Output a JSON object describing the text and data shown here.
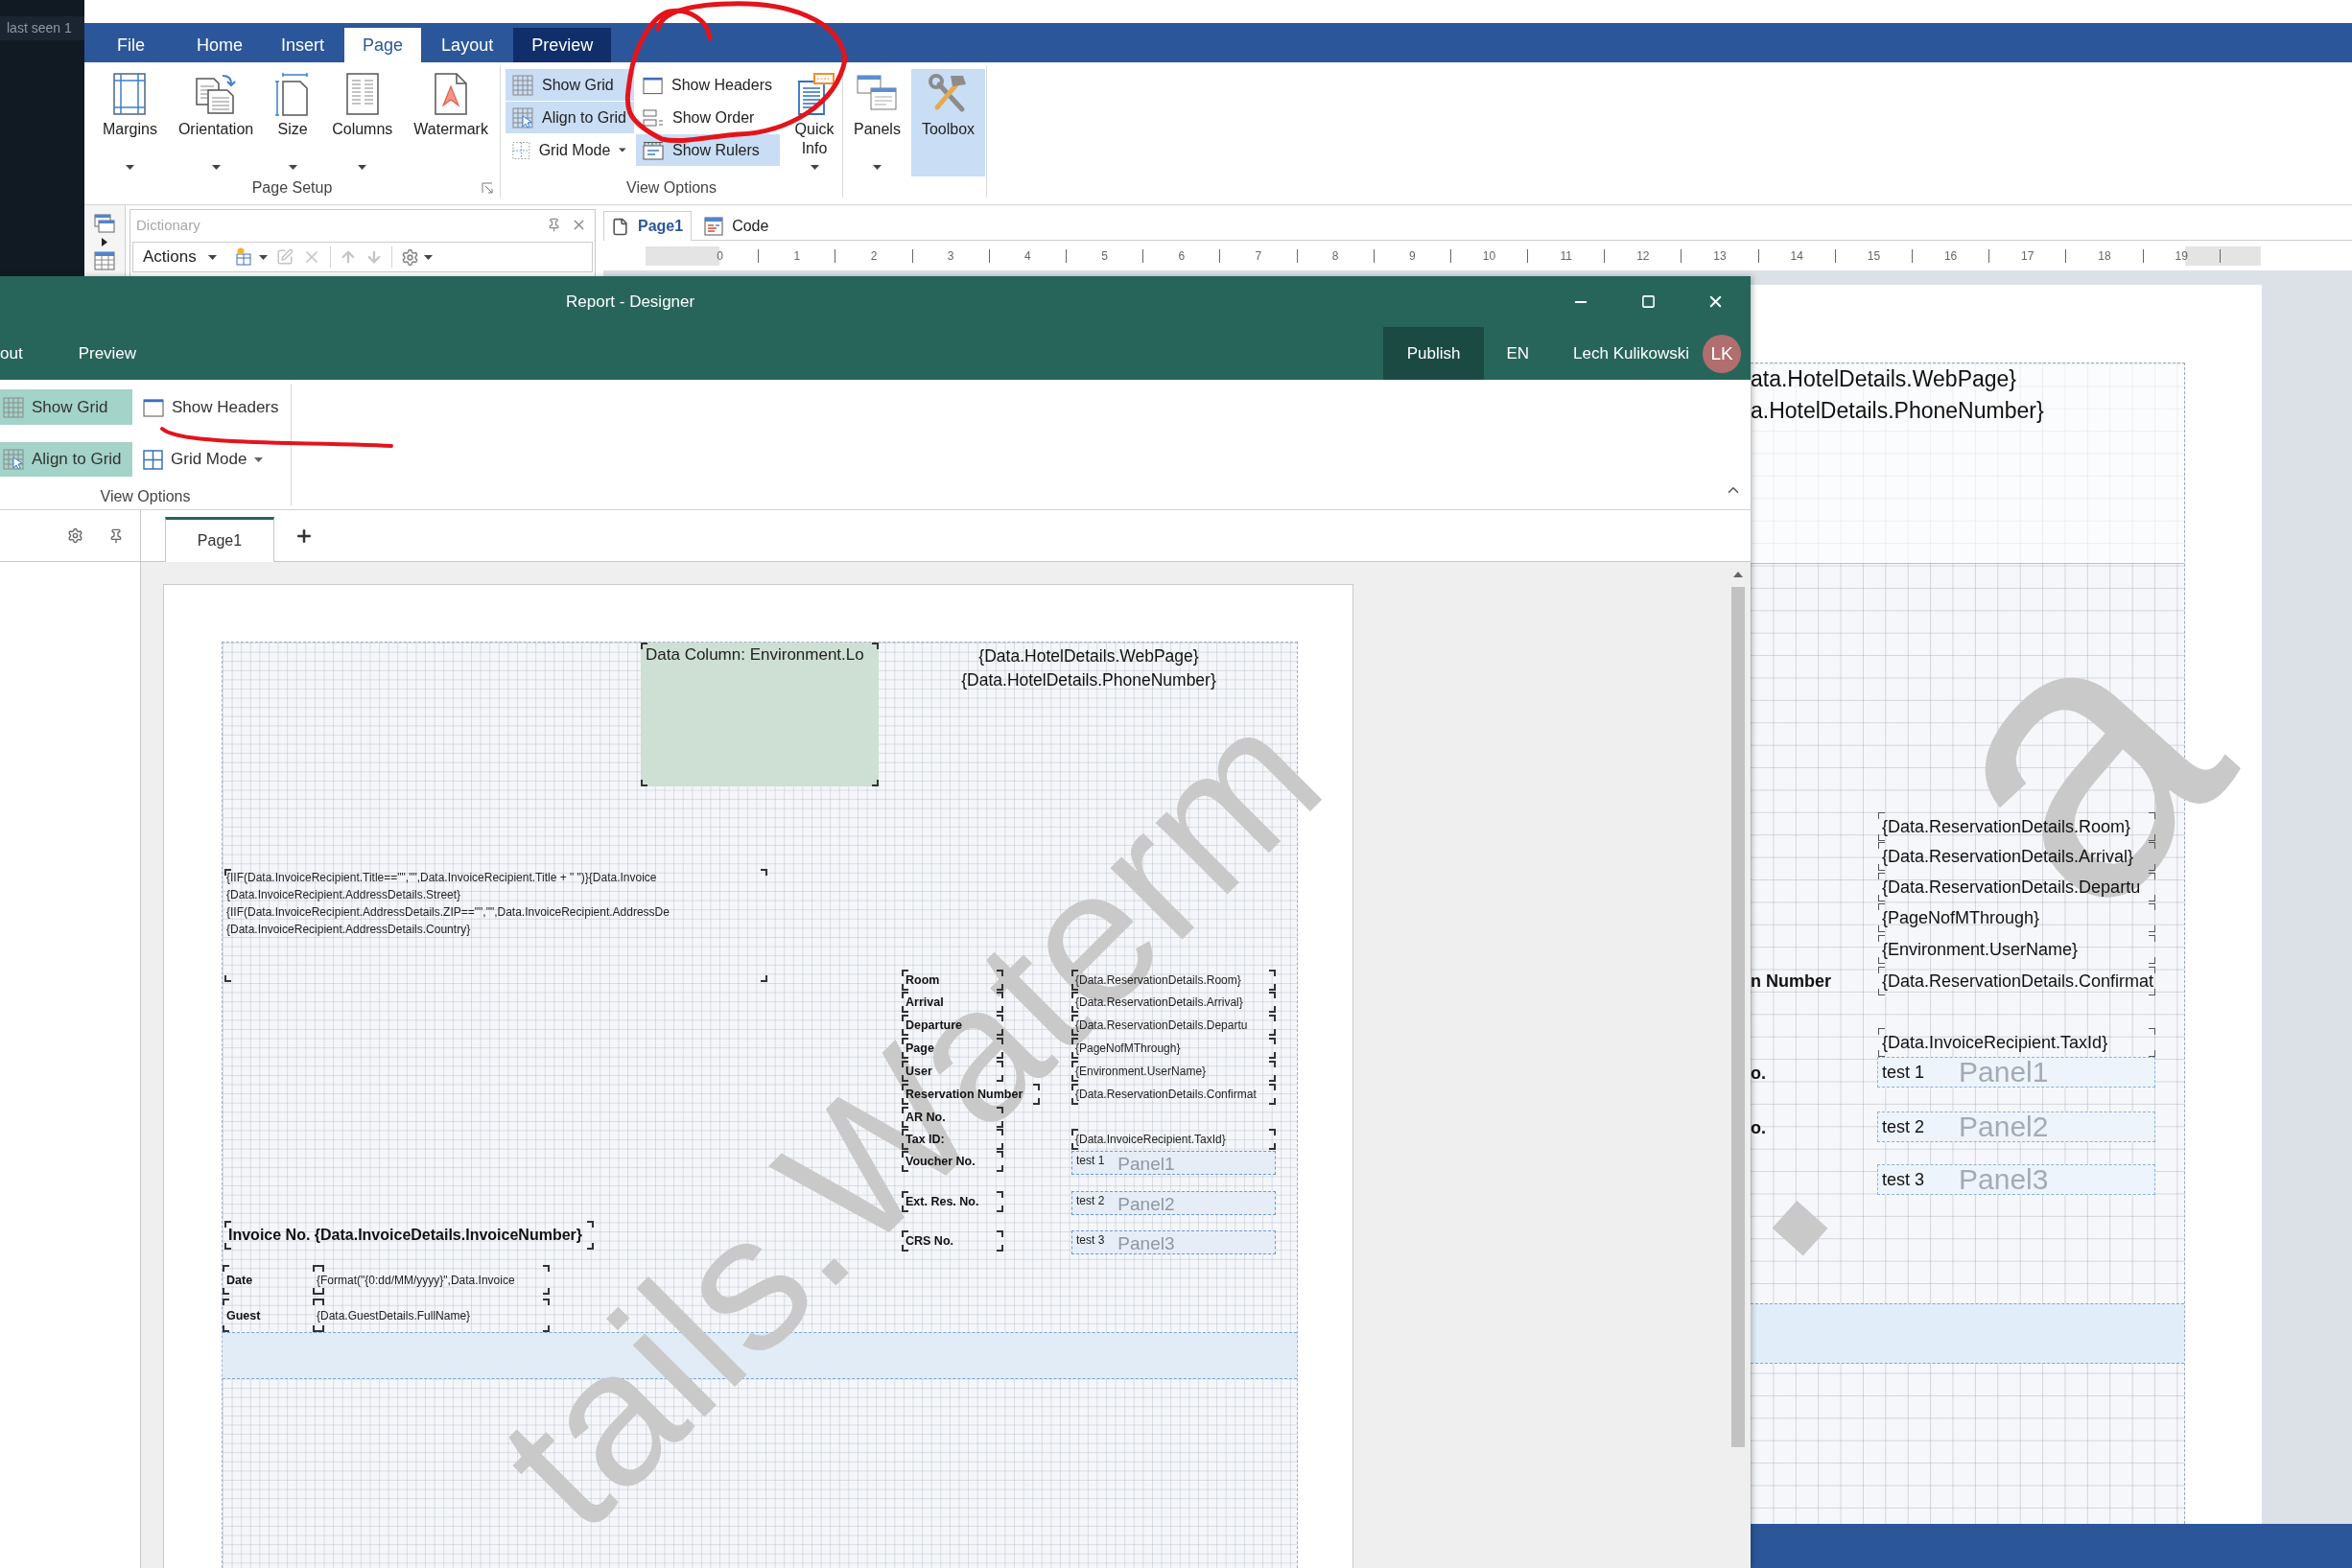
{
  "desktop_window": {
    "status": "last seen 1"
  },
  "main_app": {
    "ribbon_tabs": [
      {
        "label": "File",
        "selected": false,
        "kind": "normal"
      },
      {
        "label": "Home",
        "selected": false,
        "kind": "normal"
      },
      {
        "label": "Insert",
        "selected": false,
        "kind": "normal"
      },
      {
        "label": "Page",
        "selected": true,
        "kind": "normal"
      },
      {
        "label": "Layout",
        "selected": false,
        "kind": "normal"
      },
      {
        "label": "Preview",
        "selected": false,
        "kind": "contextual"
      }
    ],
    "page_setup": {
      "title": "Page Setup",
      "buttons": [
        {
          "label": "Margins",
          "dropdown": true
        },
        {
          "label": "Orientation",
          "dropdown": true
        },
        {
          "label": "Size",
          "dropdown": true
        },
        {
          "label": "Columns",
          "dropdown": true
        },
        {
          "label": "Watermark",
          "dropdown": false
        }
      ]
    },
    "view_options": {
      "title": "View Options",
      "items": [
        {
          "label": "Show Grid",
          "on": true,
          "dropdown": false
        },
        {
          "label": "Align to Grid",
          "on": true,
          "dropdown": false
        },
        {
          "label": "Grid Mode",
          "on": false,
          "dropdown": true
        },
        {
          "label": "Show Headers",
          "on": false,
          "dropdown": false
        },
        {
          "label": "Show Order",
          "on": false,
          "dropdown": false
        },
        {
          "label": "Show Rulers",
          "on": true,
          "dropdown": false
        }
      ],
      "quick_info": {
        "label": "Quick Info",
        "on": false,
        "dropdown": true
      }
    },
    "panels": [
      {
        "label": "Panels",
        "on": false,
        "dropdown": true
      },
      {
        "label": "Toolbox",
        "on": true,
        "dropdown": false
      }
    ],
    "dictionary": {
      "title": "Dictionary",
      "actions": "Actions"
    },
    "document_tabs": [
      {
        "label": "Page1",
        "selected": true
      },
      {
        "label": "Code",
        "selected": false
      }
    ],
    "ruler": [
      "0",
      "1",
      "2",
      "3",
      "4",
      "5",
      "6",
      "7",
      "8",
      "9",
      "10",
      "11",
      "12",
      "13",
      "14",
      "15",
      "16",
      "17",
      "18",
      "19"
    ],
    "page": {
      "header_lines": [
        "ata.HotelDetails.WebPage}",
        "a.HotelDetails.PhoneNumber}"
      ],
      "fields": [
        {
          "value": "{Data.ReservationDetails.Room}"
        },
        {
          "value": "{Data.ReservationDetails.Arrival}"
        },
        {
          "value": "{Data.ReservationDetails.Departu"
        },
        {
          "value": "{PageNofMThrough}"
        },
        {
          "value": "{Environment.UserName}"
        },
        {
          "label": "n Number",
          "value": "{Data.ReservationDetails.Confirmat"
        },
        {
          "value": "{Data.InvoiceRecipient.TaxId}"
        }
      ],
      "panels": [
        {
          "label": "o.",
          "text": "test 1",
          "caption": "Panel1"
        },
        {
          "label": "o.",
          "text": "test 2",
          "caption": "Panel2"
        },
        {
          "text": "test 3",
          "caption": "Panel3"
        }
      ],
      "watermark_fragments": [
        ".",
        "a"
      ]
    }
  },
  "designer": {
    "title": "Report - Designer",
    "menu": [
      "out",
      "Preview"
    ],
    "publish": "Publish",
    "language": "EN",
    "user": "Lech Kulikowski",
    "avatar": "LK",
    "view_options": {
      "title": "View Options",
      "items": [
        {
          "label": "Show Grid",
          "on": true,
          "dropdown": false
        },
        {
          "label": "Show Headers",
          "on": false,
          "dropdown": false
        },
        {
          "label": "Align to Grid",
          "on": true,
          "dropdown": false
        },
        {
          "label": "Grid Mode",
          "on": false,
          "dropdown": true
        }
      ]
    },
    "tabs": [
      {
        "label": "Page1",
        "selected": true
      }
    ],
    "report": {
      "data_column": "Data Column: Environment.Lo",
      "header_lines": [
        "{Data.HotelDetails.WebPage}",
        "{Data.HotelDetails.PhoneNumber}"
      ],
      "address_lines": [
        "{IIF(Data.InvoiceRecipient.Title==\"\",\"\",Data.InvoiceRecipient.Title + \" \")}{Data.Invoice",
        "{Data.InvoiceRecipient.AddressDetails.Street}",
        "{IIF(Data.InvoiceRecipient.AddressDetails.ZIP==\"\",\"\",Data.InvoiceRecipient.AddressDe",
        "{Data.InvoiceRecipient.AddressDetails.Country}"
      ],
      "details": [
        {
          "label": "Room",
          "value": "{Data.ReservationDetails.Room}"
        },
        {
          "label": "Arrival",
          "value": "{Data.ReservationDetails.Arrival}"
        },
        {
          "label": "Departure",
          "value": "{Data.ReservationDetails.Departu"
        },
        {
          "label": "Page",
          "value": "{PageNofMThrough}"
        },
        {
          "label": "User",
          "value": "{Environment.UserName}"
        },
        {
          "label": "Reservation Number",
          "value": "{Data.ReservationDetails.Confirmat"
        },
        {
          "label": "AR No."
        },
        {
          "label": "Tax ID:",
          "value": "{Data.InvoiceRecipient.TaxId}"
        },
        {
          "label": "Voucher No.",
          "panel": {
            "text": "test 1",
            "caption": "Panel1"
          }
        },
        {
          "label": "Ext. Res. No.",
          "panel": {
            "text": "test 2",
            "caption": "Panel2"
          }
        },
        {
          "label": "CRS No.",
          "panel": {
            "text": "test 3",
            "caption": "Panel3"
          }
        }
      ],
      "invoice_title": "Invoice No. {Data.InvoiceDetails.InvoiceNumber}",
      "summary": [
        {
          "label": "Date",
          "value": "{Format(\"{0:dd/MM/yyyy}\",Data.Invoice"
        },
        {
          "label": "Guest",
          "value": "{Data.GuestDetails.FullName}"
        }
      ],
      "watermark": "tails.Waterm"
    }
  }
}
